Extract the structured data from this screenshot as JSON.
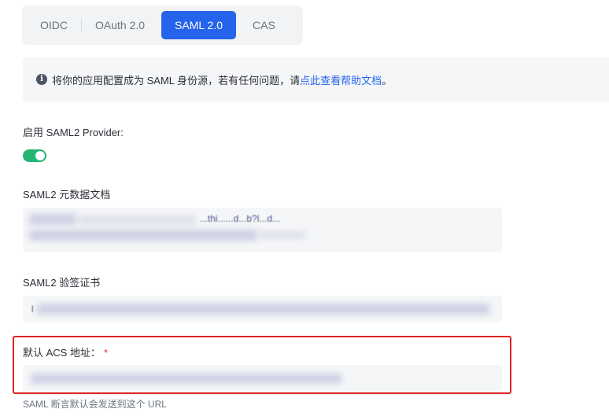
{
  "tabs": [
    {
      "label": "OIDC",
      "active": false
    },
    {
      "label": "OAuth 2.0",
      "active": false
    },
    {
      "label": "SAML 2.0",
      "active": true
    },
    {
      "label": "CAS",
      "active": false
    }
  ],
  "banner": {
    "icon": "info-circle-icon",
    "text": "将你的应用配置成为 SAML 身份源，若有任何问题，请 ",
    "link": "点此查看帮助文档",
    "suffix": "。"
  },
  "provider": {
    "label": "启用 SAML2 Provider:",
    "enabled": true,
    "switch_color": "#22b573"
  },
  "metadata": {
    "label": "SAML2 元数据文档",
    "visible_fragment": "...thi......d...b?l...d..."
  },
  "certificate": {
    "label": "SAML2 验签证书",
    "visible_fragment": "l"
  },
  "acs": {
    "label": "默认 ACS 地址：",
    "required_mark": "*",
    "help": "SAML 断言默认会发送到这个 URL"
  },
  "colors": {
    "accent": "#2563eb",
    "highlight": "#e02424"
  }
}
